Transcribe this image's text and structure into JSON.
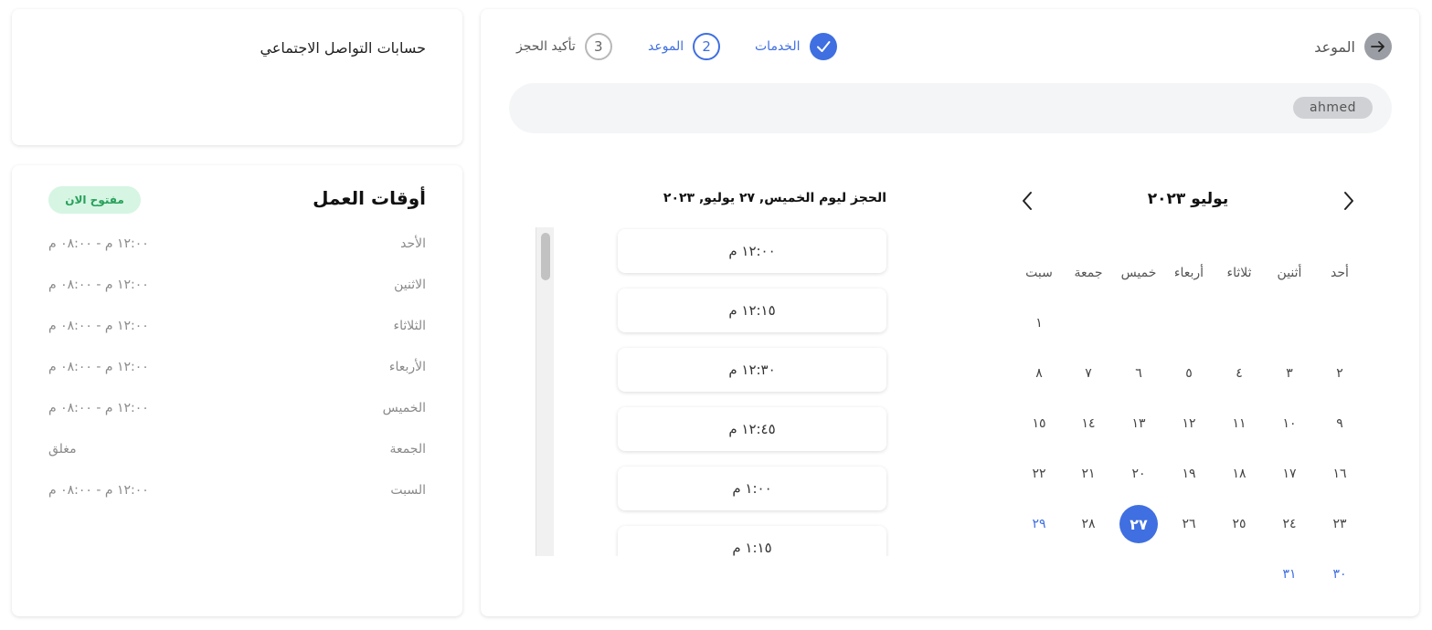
{
  "social": {
    "title": "حسابات التواصل الاجتماعي"
  },
  "hours": {
    "title": "أوقات العمل",
    "status_badge": "مفتوح الان",
    "rows": [
      {
        "day": "الأحد",
        "time": "١٢:٠٠ م - ٠٨:٠٠ م"
      },
      {
        "day": "الاثنين",
        "time": "١٢:٠٠ م - ٠٨:٠٠ م"
      },
      {
        "day": "الثلاثاء",
        "time": "١٢:٠٠ م - ٠٨:٠٠ م"
      },
      {
        "day": "الأربعاء",
        "time": "١٢:٠٠ م - ٠٨:٠٠ م"
      },
      {
        "day": "الخميس",
        "time": "١٢:٠٠ م - ٠٨:٠٠ م"
      },
      {
        "day": "الجمعة",
        "time": "مغلق"
      },
      {
        "day": "السبت",
        "time": "١٢:٠٠ م - ٠٨:٠٠ م"
      }
    ]
  },
  "header": {
    "back_label": "الموعد",
    "steps": [
      {
        "number": "✓",
        "label": "الخدمات",
        "state": "done"
      },
      {
        "number": "2",
        "label": "الموعد",
        "state": "active"
      },
      {
        "number": "3",
        "label": "تأكيد الحجز",
        "state": "pending"
      }
    ]
  },
  "user": {
    "chip": "ahmed"
  },
  "calendar": {
    "month_label": "يوليو ٢٠٢٣",
    "weekdays": [
      "أحد",
      "أثنين",
      "ثلاثاء",
      "أربعاء",
      "خميس",
      "جمعة",
      "سبت"
    ],
    "weeks": [
      [
        "",
        "",
        "",
        "",
        "",
        "",
        "١"
      ],
      [
        "٢",
        "٣",
        "٤",
        "٥",
        "٦",
        "٧",
        "٨"
      ],
      [
        "٩",
        "١٠",
        "١١",
        "١٢",
        "١٣",
        "١٤",
        "١٥"
      ],
      [
        "١٦",
        "١٧",
        "١٨",
        "١٩",
        "٢٠",
        "٢١",
        "٢٢"
      ],
      [
        "٢٣",
        "٢٤",
        "٢٥",
        "٢٦",
        "٢٧",
        "٢٨",
        "٢٩"
      ],
      [
        "٣٠",
        "٣١",
        "",
        "",
        "",
        "",
        ""
      ]
    ],
    "selected": "٢٧",
    "highlighted": [
      "٢٩",
      "٣٠",
      "٣١"
    ],
    "selected_color": "#3f6fe0",
    "accent_color": "#3f6fe0"
  },
  "slots": {
    "title": "الحجز ليوم الخميس, ٢٧ يوليو, ٢٠٢٣",
    "times": [
      "١٢:٠٠ م",
      "١٢:١٥ م",
      "١٢:٣٠ م",
      "١٢:٤٥ م",
      "١:٠٠ م",
      "١:١٥ م"
    ]
  }
}
